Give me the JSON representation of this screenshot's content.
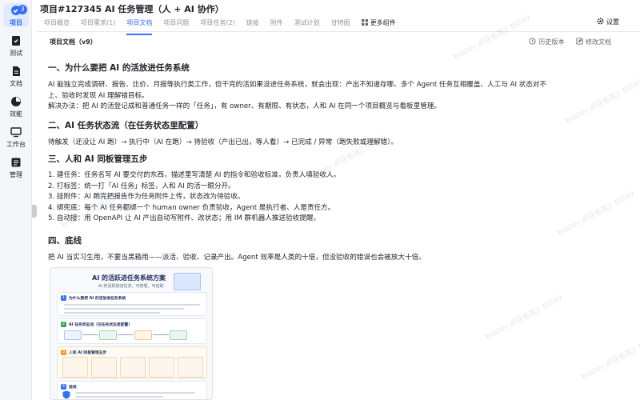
{
  "rail": {
    "items": [
      {
        "label": "项目",
        "icon": "project-icon",
        "badge": "3",
        "active": true
      },
      {
        "label": "测试",
        "icon": "test-icon"
      },
      {
        "label": "文档",
        "icon": "document-icon"
      },
      {
        "label": "效能",
        "icon": "efficiency-icon"
      },
      {
        "label": "工作台",
        "icon": "workbench-icon"
      },
      {
        "label": "管理",
        "icon": "admin-icon"
      }
    ]
  },
  "header": {
    "title": "项目#127345 AI 任务管理（人 + AI 协作）",
    "tabs": [
      {
        "label": "项目概览"
      },
      {
        "label": "项目需求(1)"
      },
      {
        "label": "项目文档",
        "active": true
      },
      {
        "label": "项目问题"
      },
      {
        "label": "项目任务(2)"
      },
      {
        "label": "链接"
      },
      {
        "label": "附件"
      },
      {
        "label": "测试计划"
      },
      {
        "label": "甘特图"
      },
      {
        "label": "更多组件",
        "icon": "grid-icon"
      }
    ],
    "settings": "设置",
    "accent": "#3370ff"
  },
  "doc": {
    "title": "项目文档（v9）",
    "history": "历史版本",
    "edit": "修改文档",
    "sections": [
      {
        "heading": "一、为什么要把 AI 的活放进任务系统",
        "paragraphs": [
          "AI 能独立完成调研、报告、比价、月报等执行类工作，但干完的活如果没进任务系统，就会出现：产出不知道存哪、多个 Agent 任务互相覆盖、人工与 AI 状态对不",
          "上、验收时发现 AI 理解错目标。",
          "解决办法：把 AI 的活登记成和普通任务一样的「任务」，有 owner、有期限、有状态，人和 AI 在同一个项目概览与看板里管理。"
        ]
      },
      {
        "heading": "二、AI 任务状态流（在任务状态里配置）",
        "paragraphs": [
          "待触发（还没让 AI 跑）→ 执行中（AI 在跑）→ 待验收（产出已出，等人看）→ 已完成 / 异常（跑失败或理解错）。"
        ]
      },
      {
        "heading": "三、人和 AI 同板管理五步",
        "paragraphs": [
          "1. 建任务：任务名写 AI 要交付的东西，描述里写清楚 AI 的指令和验收标准，负责人填验收人。",
          "2. 打标签：统一打「AI 任务」标签，人和 AI 的活一眼分开。",
          "3. 挂附件：AI 跑完把报告作为任务附件上传，状态改为待验收。",
          "4. 绑兜底：每个 AI 任务都绑一个 human owner 负责验收，Agent 是执行者、人是责任方。",
          "5. 自动接：用 OpenAPI 让 AI 产出自动写附件、改状态；用 IM 群机器人推送验收提醒。"
        ]
      },
      {
        "heading": "四、底线",
        "paragraphs": [
          "把 AI 当实习生用，不要当黑箱用——派活、验收、记录产出。Agent 效率是人类的十倍，但没验收的错误也会被放大十倍。"
        ]
      }
    ]
  },
  "infographic": {
    "title": "AI 的活跃进任务系统方案",
    "subtitle": "AI 的活跃放进任务，可管理、可追踪",
    "cards": [
      {
        "num": "1",
        "title": "为什么要把 AI 的活放进任务系统"
      },
      {
        "num": "2",
        "title": "AI 任务状态流（在任务状态里配置）"
      },
      {
        "num": "3",
        "title": "人和 AI 同板管理五步"
      },
      {
        "num": "4",
        "title": "底线"
      }
    ]
  },
  "watermark": "YesDev 项目管理2 35049"
}
